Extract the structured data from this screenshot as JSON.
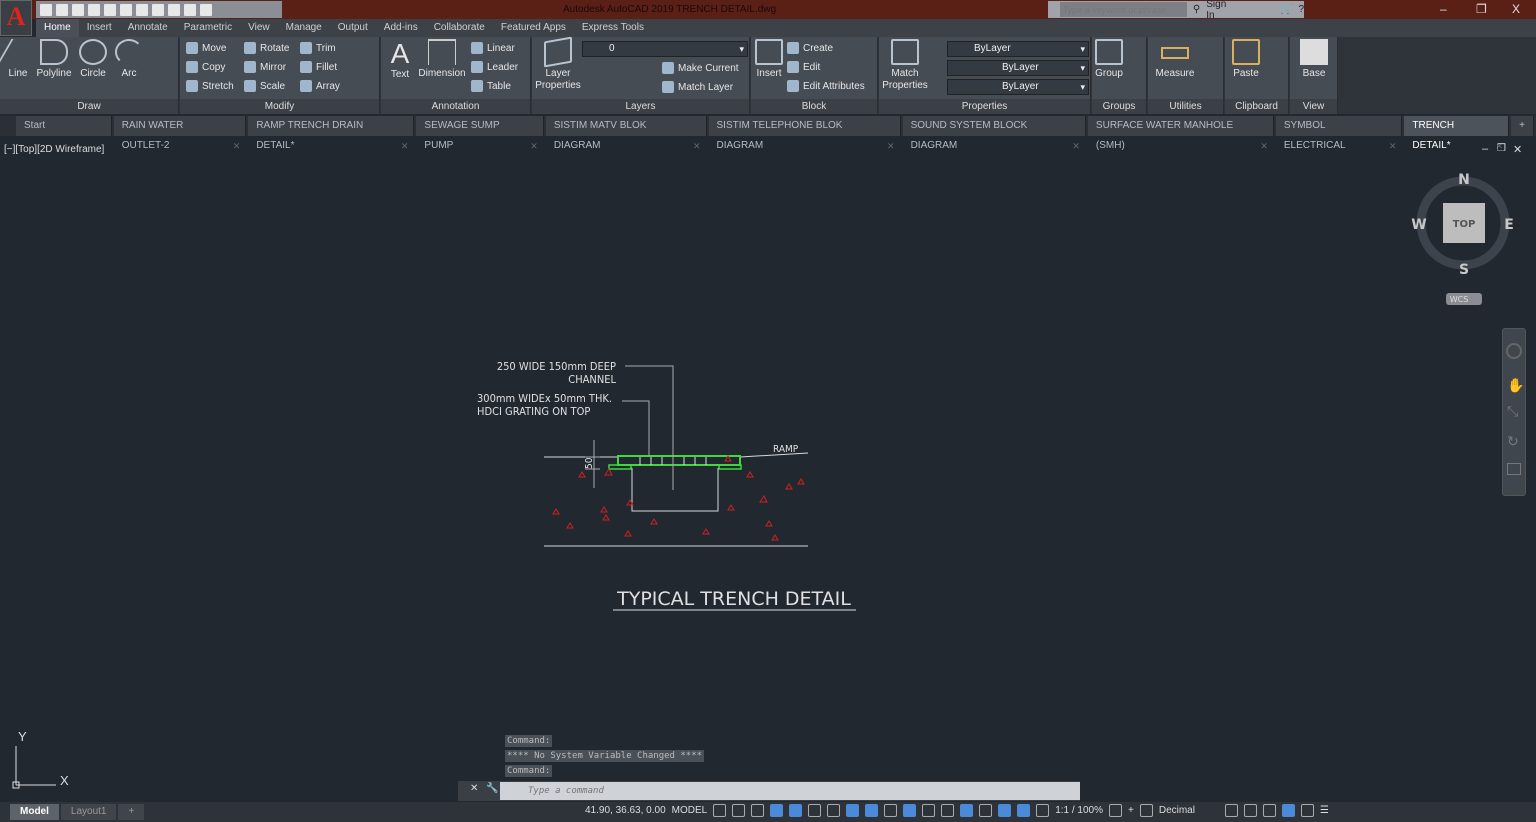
{
  "title_bar": {
    "app_title": "Autodesk AutoCAD 2019    TRENCH DETAIL.dwg",
    "search_placeholder": "Type a keyword or phrase",
    "sign_in": "Sign In",
    "minimize": "–",
    "restore": "❐",
    "close": "X",
    "app_letter": "A"
  },
  "ribbon_tabs": [
    "Home",
    "Insert",
    "Annotate",
    "Parametric",
    "View",
    "Manage",
    "Output",
    "Add-ins",
    "Collaborate",
    "Featured Apps",
    "Express Tools"
  ],
  "panels": {
    "draw": {
      "label": "Draw",
      "line": "Line",
      "polyline": "Polyline",
      "circle": "Circle",
      "arc": "Arc"
    },
    "modify": {
      "label": "Modify",
      "move": "Move",
      "rotate": "Rotate",
      "trim": "Trim",
      "copy": "Copy",
      "mirror": "Mirror",
      "fillet": "Fillet",
      "stretch": "Stretch",
      "scale": "Scale",
      "array": "Array"
    },
    "annotation": {
      "label": "Annotation",
      "text": "Text",
      "dimension": "Dimension",
      "linear": "Linear",
      "leader": "Leader",
      "table": "Table"
    },
    "layers": {
      "label": "Layers",
      "layer_properties": "Layer Properties",
      "current_layer": "0",
      "make_current": "Make Current",
      "match_layer": "Match Layer"
    },
    "block": {
      "label": "Block",
      "insert": "Insert",
      "create": "Create",
      "edit": "Edit",
      "edit_attributes": "Edit Attributes"
    },
    "properties": {
      "label": "Properties",
      "match_properties": "Match Properties",
      "color": "ByLayer",
      "linetype": "ByLayer",
      "lineweight": "ByLayer"
    },
    "groups": {
      "label": "Groups",
      "group": "Group"
    },
    "utilities": {
      "label": "Utilities",
      "measure": "Measure"
    },
    "clipboard": {
      "label": "Clipboard",
      "paste": "Paste"
    },
    "view": {
      "label": "View",
      "base": "Base"
    }
  },
  "file_tabs": [
    {
      "label": "Start"
    },
    {
      "label": "RAIN WATER OUTLET-2"
    },
    {
      "label": "RAMP TRENCH DRAIN DETAIL*"
    },
    {
      "label": "SEWAGE SUMP PUMP"
    },
    {
      "label": "SISTIM MATV BLOK DIAGRAM"
    },
    {
      "label": "SISTIM TELEPHONE BLOK DIAGRAM"
    },
    {
      "label": "SOUND SYSTEM BLOCK DIAGRAM"
    },
    {
      "label": "SURFACE WATER MANHOLE (SMH)"
    },
    {
      "label": "SYMBOL ELECTRICAL"
    },
    {
      "label": "TRENCH DETAIL*",
      "active": true
    }
  ],
  "viewport": {
    "controls": "[−][Top][2D Wireframe]"
  },
  "viewcube": {
    "n": "N",
    "s": "S",
    "e": "E",
    "w": "W",
    "face": "TOP",
    "ucs": "WCS"
  },
  "drawing": {
    "note1_line1": "250 WIDE 150mm DEEP",
    "note1_line2": "CHANNEL",
    "note2_line1": "300mm WIDEx 50mm THK.",
    "note2_line2": "HDCI GRATING ON TOP",
    "ramp": "RAMP",
    "dim": "50",
    "title": "TYPICAL TRENCH DETAIL"
  },
  "ucs_icon": {
    "x": "X",
    "y": "Y"
  },
  "command": {
    "history": [
      "Command:",
      "**** No System Variable Changed ****",
      "Command:"
    ],
    "placeholder": "Type a command"
  },
  "layout_tabs": [
    "Model",
    "Layout1"
  ],
  "status": {
    "coords": "41.90, 36.63, 0.00",
    "space": "MODEL",
    "scale": "1:1 / 100%",
    "units": "Decimal"
  }
}
